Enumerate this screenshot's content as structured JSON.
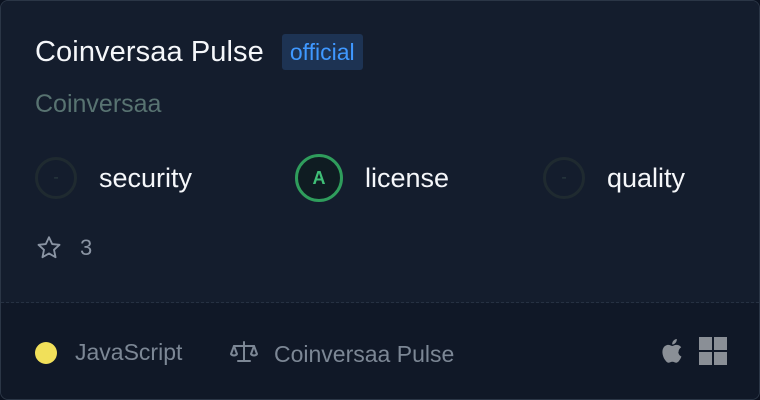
{
  "package": {
    "name": "Coinversaa Pulse",
    "badge": "official",
    "owner": "Coinversaa"
  },
  "scores": [
    {
      "grade": "-",
      "label": "security",
      "status": "none"
    },
    {
      "grade": "A",
      "label": "license",
      "status": "good"
    },
    {
      "grade": "-",
      "label": "quality",
      "status": "none"
    }
  ],
  "stars": {
    "count": "3",
    "icon": "star-icon"
  },
  "footer": {
    "language": "JavaScript",
    "language_color": "#f1e05a",
    "license": "Coinversaa Pulse",
    "license_icon": "scale-icon",
    "platforms": [
      "apple-icon",
      "windows-icon"
    ]
  },
  "colors": {
    "accent_badge": "#3f98ff",
    "grade_good": "#2f9d5c"
  }
}
